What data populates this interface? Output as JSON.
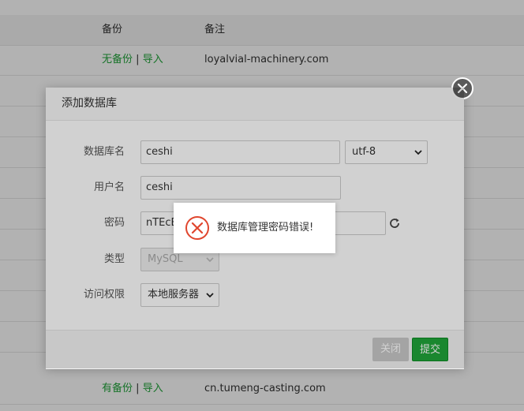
{
  "table": {
    "headers": {
      "backup": "备份",
      "note": "备注"
    },
    "rows": [
      {
        "backup_status": "无备份",
        "import": "导入",
        "note": "loyalvial-machinery.com"
      },
      {
        "backup_status": "有备份",
        "import": "导入",
        "note": "cn.tumeng-casting.com"
      }
    ],
    "separator": "|"
  },
  "modal": {
    "title": "添加数据库",
    "fields": {
      "db_name_label": "数据库名",
      "db_name_value": "ceshi",
      "charset_value": "utf-8",
      "username_label": "用户名",
      "username_value": "ceshi",
      "password_label": "密码",
      "password_value": "nTEcEt",
      "type_label": "类型",
      "type_value": "MySQL",
      "access_label": "访问权限",
      "access_value": "本地服务器"
    },
    "buttons": {
      "close": "关闭",
      "submit": "提交"
    }
  },
  "toast": {
    "message": "数据库管理密码错误!",
    "icon": "error-circle-icon"
  },
  "colors": {
    "accent_green": "#20a53a",
    "error_red": "#e0462e"
  }
}
